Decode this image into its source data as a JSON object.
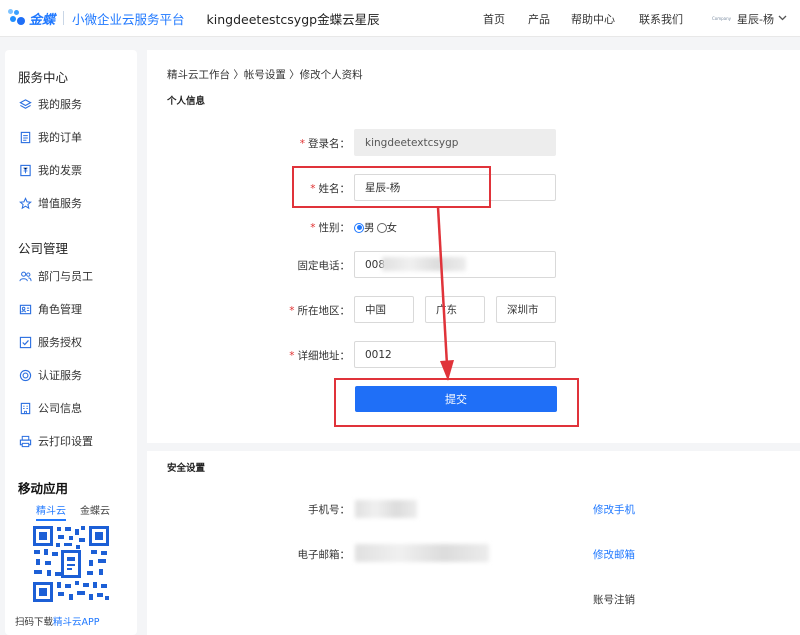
{
  "header": {
    "brand": "金蝶",
    "subtitle": "小微企业云服务平台",
    "title": "kingdeetestcsygp金蝶云星辰",
    "nav": [
      "首页",
      "产品",
      "帮助中心",
      "联系我们"
    ],
    "user_avatar_text": "Company",
    "user_name": "星辰-杨"
  },
  "sidebar": {
    "service_center_title": "服务中心",
    "service_items": [
      {
        "label": "我的服务",
        "icon": "layers-icon"
      },
      {
        "label": "我的订单",
        "icon": "document-icon"
      },
      {
        "label": "我的发票",
        "icon": "invoice-icon"
      },
      {
        "label": "增值服务",
        "icon": "star-icon"
      }
    ],
    "company_title": "公司管理",
    "company_items": [
      {
        "label": "部门与员工",
        "icon": "users-icon"
      },
      {
        "label": "角色管理",
        "icon": "id-card-icon"
      },
      {
        "label": "服务授权",
        "icon": "checkbox-icon"
      },
      {
        "label": "认证服务",
        "icon": "target-icon"
      },
      {
        "label": "公司信息",
        "icon": "building-icon"
      },
      {
        "label": "云打印设置",
        "icon": "printer-icon"
      }
    ],
    "mobile_title": "移动应用",
    "mobile_tabs": [
      "精斗云",
      "金蝶云"
    ],
    "qr_caption_prefix": "扫码下载",
    "qr_caption_highlight": "精斗云APP"
  },
  "main": {
    "breadcrumb": "精斗云工作台 〉帐号设置 〉修改个人资料",
    "personal_section": "个人信息",
    "form": {
      "login_label": "登录名：",
      "login_value": "kingdeetextcsygp",
      "name_label": "姓名：",
      "name_value": "星辰-杨",
      "gender_label": "性别：",
      "gender_male": "男",
      "gender_female": "女",
      "phone_label": "固定电话：",
      "phone_value": "008",
      "region_label": "所在地区：",
      "region_country": "中国",
      "region_province": "广东",
      "region_city": "深圳市",
      "address_label": "详细地址：",
      "address_value": "0012",
      "submit": "提交"
    },
    "security_section": "安全设置",
    "security": {
      "phone_label": "手机号：",
      "phone_action": "修改手机",
      "email_label": "电子邮箱：",
      "email_action": "修改邮箱",
      "cancel_account": "账号注销"
    }
  },
  "colors": {
    "accent": "#1f6ff7",
    "link": "#1f78ff",
    "required": "#e03131",
    "annotation": "#e0333a"
  }
}
